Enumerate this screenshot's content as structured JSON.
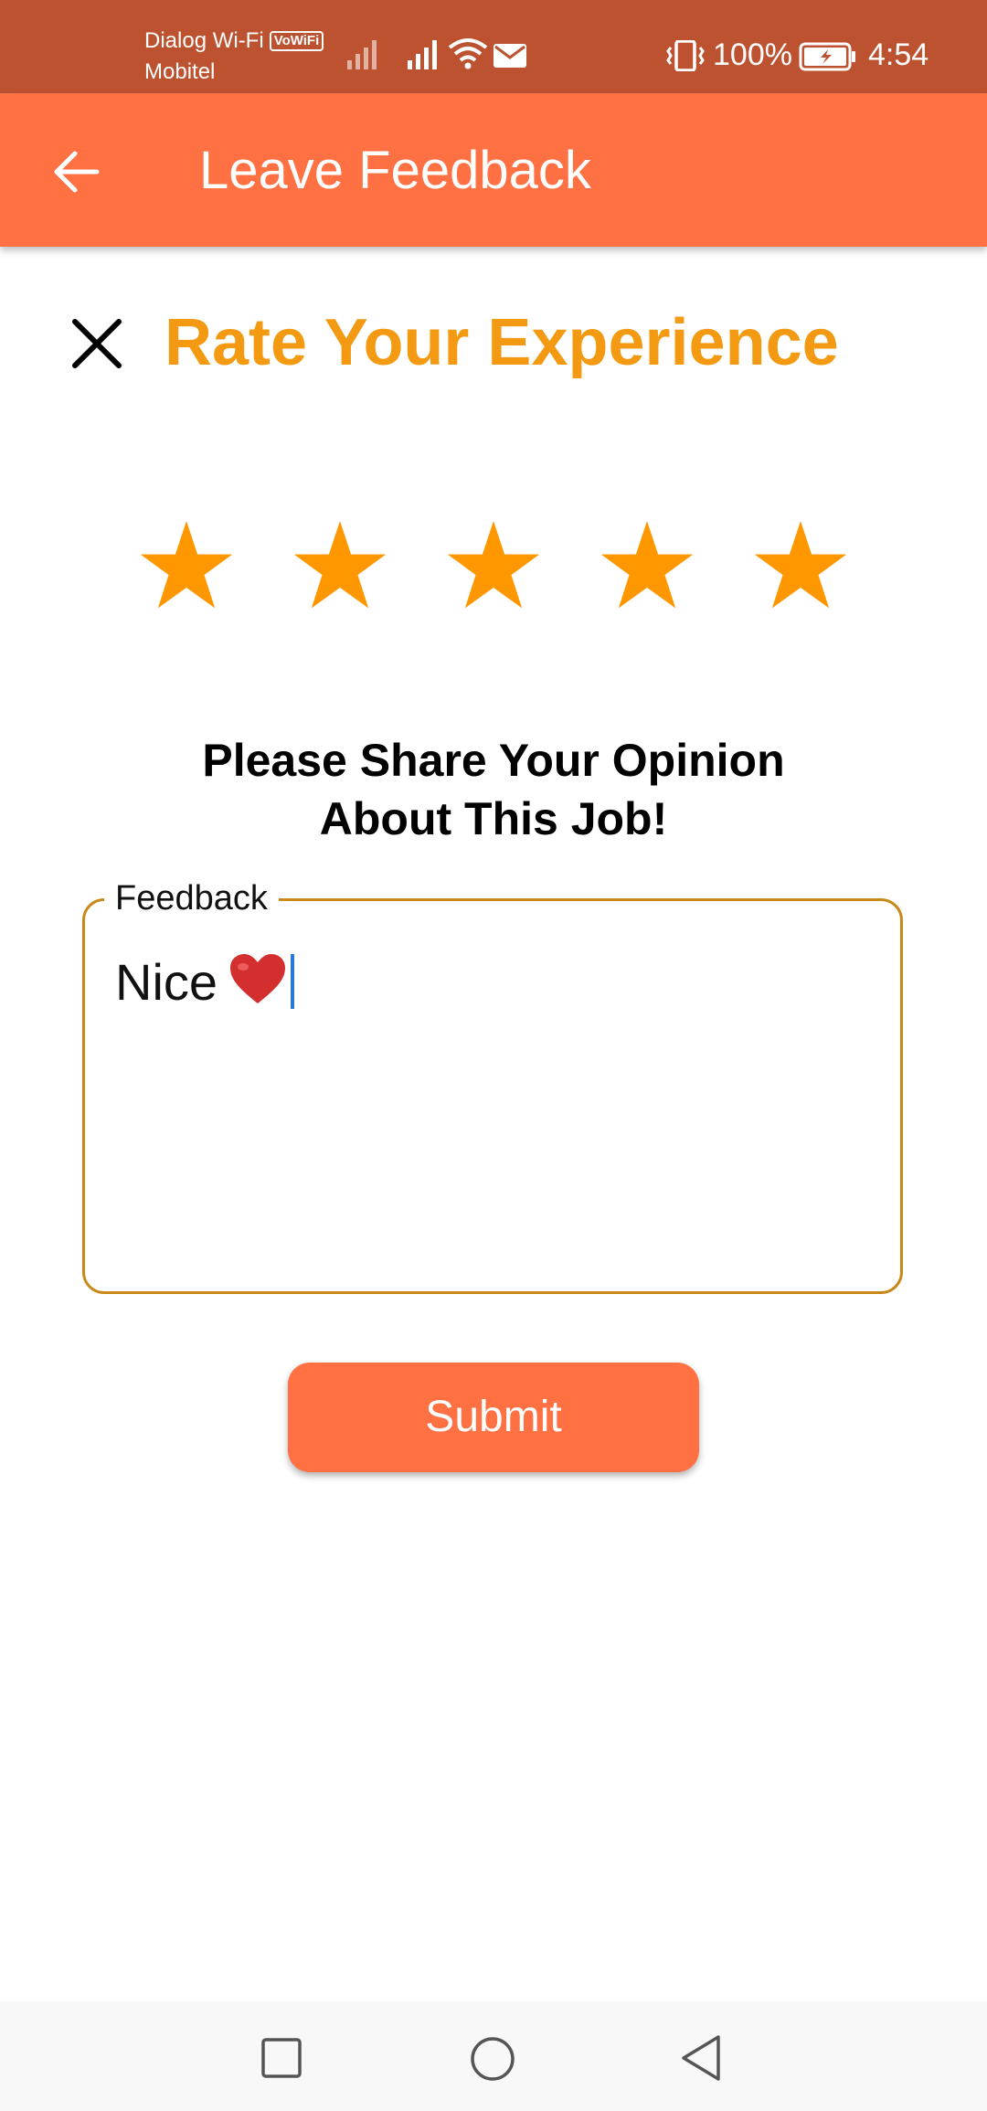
{
  "status_bar": {
    "carrier_primary": "Dialog Wi-Fi",
    "vowifi_badge": "VoWiFi",
    "carrier_secondary": "Mobitel",
    "battery_percent": "100%",
    "time": "4:54",
    "icons": [
      "signal-icon",
      "signal-icon",
      "wifi-icon",
      "mail-icon",
      "vibrate-icon",
      "battery-charging-icon"
    ]
  },
  "app_bar": {
    "title": "Leave Feedback",
    "back_icon": "arrow-left-icon",
    "background_color": "#ff7043"
  },
  "rating": {
    "title": "Rate Your Experience",
    "close_icon": "close-icon",
    "stars_total": 5,
    "stars_selected": 5,
    "star_color": "#ff9800",
    "title_color": "#f39a12"
  },
  "prompt": {
    "line1": "Please Share Your Opinion",
    "line2": "About This Job!"
  },
  "feedback": {
    "label": "Feedback",
    "value": "Nice",
    "emoji_icon": "red-heart-icon"
  },
  "submit": {
    "label": "Submit"
  },
  "nav_bar": {
    "icons": [
      "recent-apps-icon",
      "home-icon",
      "back-icon"
    ]
  }
}
